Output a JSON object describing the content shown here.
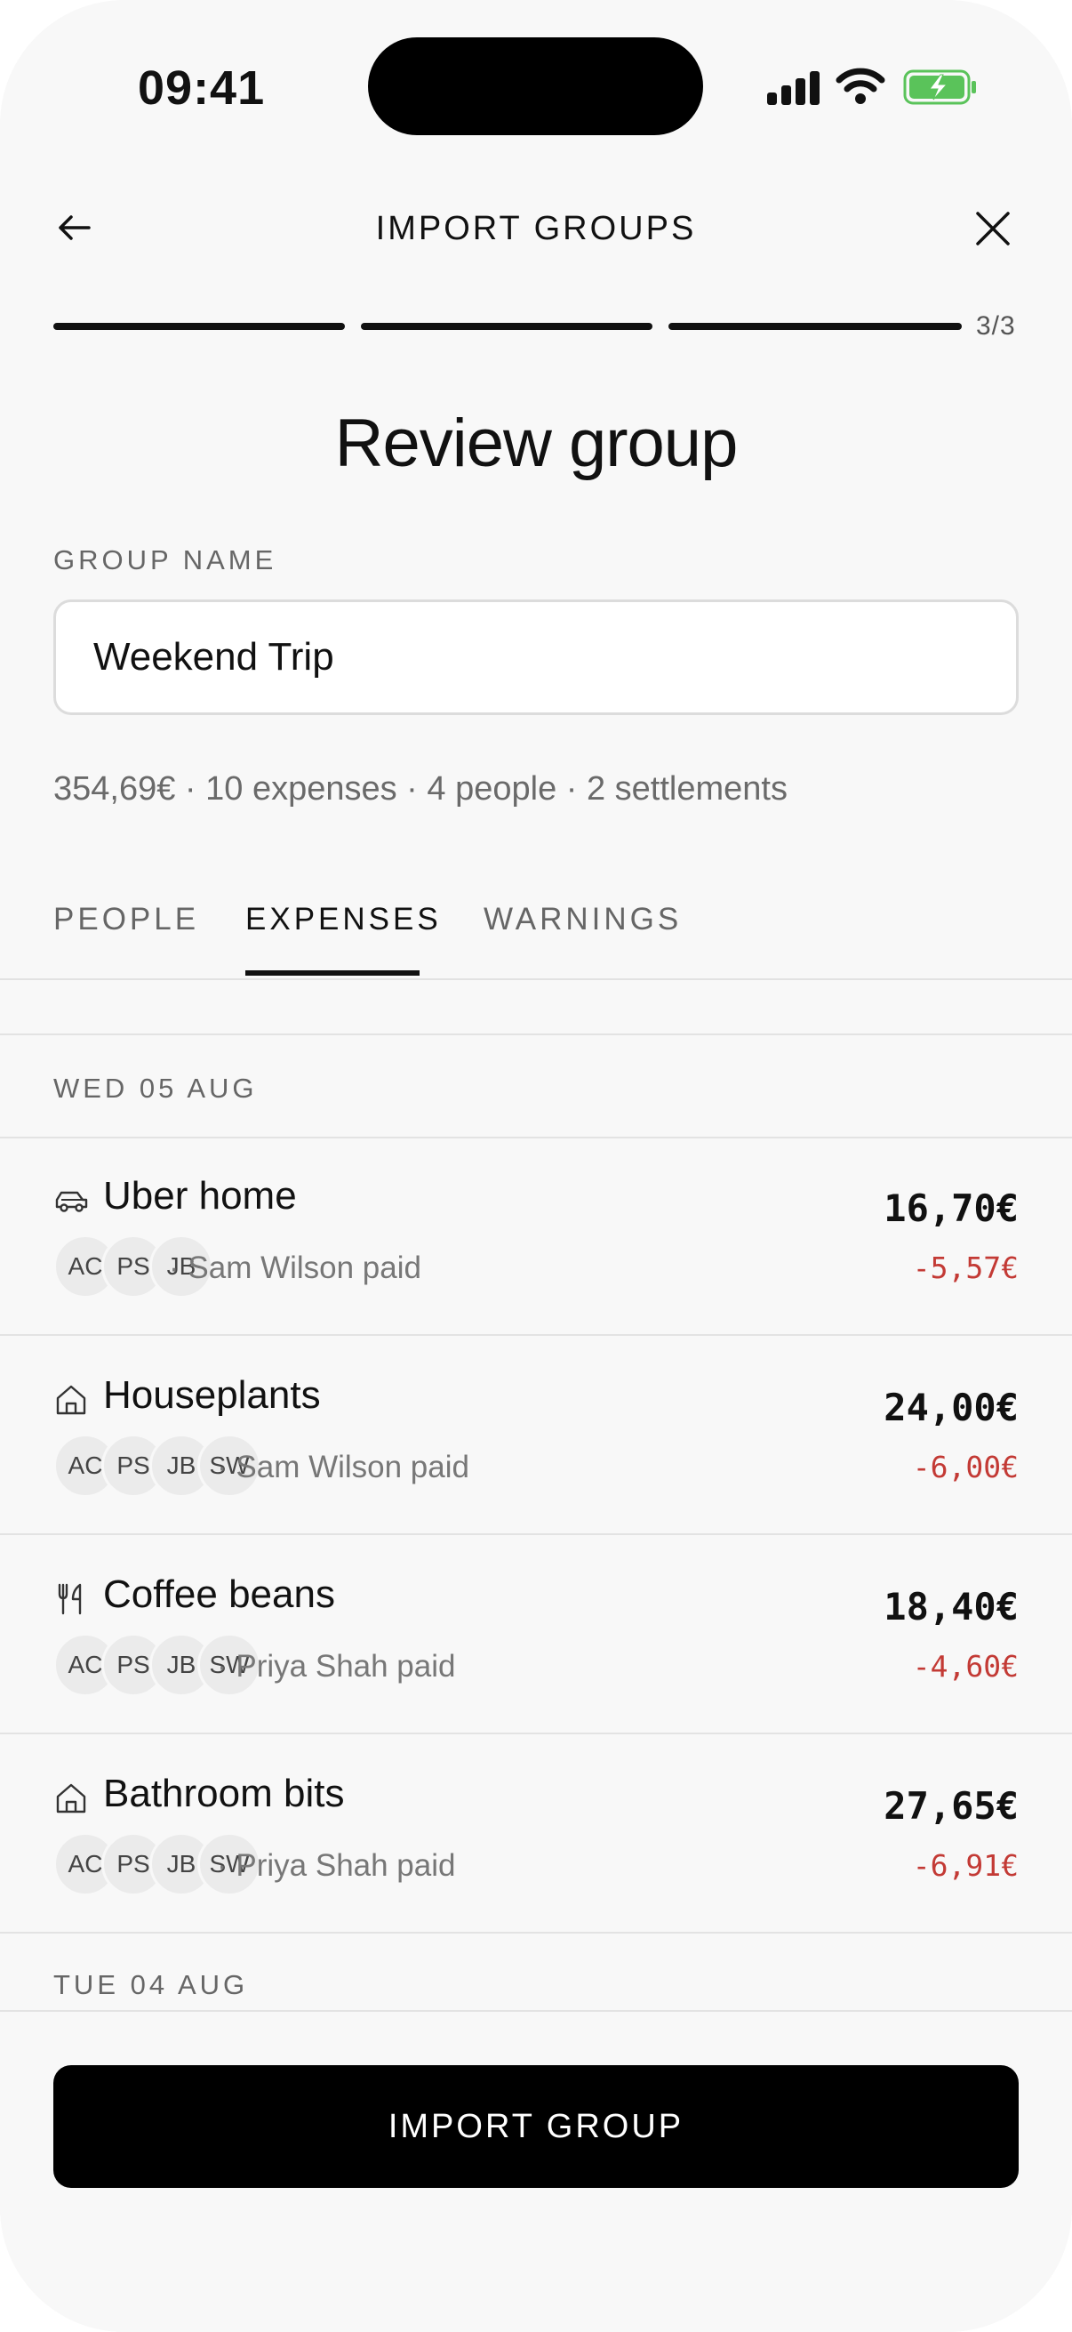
{
  "status_bar": {
    "time": "09:41"
  },
  "header": {
    "title": "IMPORT GROUPS",
    "step": "3/3"
  },
  "page_title": "Review group",
  "group_name": {
    "label": "GROUP NAME",
    "value": "Weekend Trip"
  },
  "summary": "354,69€ · 10 expenses · 4 people · 2 settlements",
  "progress": {
    "completed_steps": 3,
    "total_steps": 3
  },
  "tabs": [
    {
      "label": "PEOPLE",
      "active": false
    },
    {
      "label": "EXPENSES",
      "active": true
    },
    {
      "label": "WARNINGS",
      "active": false
    }
  ],
  "days": [
    {
      "label": "WED 05 AUG",
      "expenses": [
        {
          "title": "Uber home",
          "icon": "car-icon",
          "avatars": [
            "AC",
            "PS",
            "JB"
          ],
          "paid": "· Sam Wilson paid",
          "amount": "16,70€",
          "share": "-5,57€"
        },
        {
          "title": "Houseplants",
          "icon": "home-icon",
          "avatars": [
            "AC",
            "PS",
            "JB",
            "SW"
          ],
          "paid": "· Sam Wilson paid",
          "amount": "24,00€",
          "share": "-6,00€"
        },
        {
          "title": "Coffee beans",
          "icon": "cutlery-icon",
          "avatars": [
            "AC",
            "PS",
            "JB",
            "SW"
          ],
          "paid": "· Priya Shah paid",
          "amount": "18,40€",
          "share": "-4,60€"
        },
        {
          "title": "Bathroom bits",
          "icon": "home-icon",
          "avatars": [
            "AC",
            "PS",
            "JB",
            "SW"
          ],
          "paid": "· Priya Shah paid",
          "amount": "27,65€",
          "share": "-6,91€"
        }
      ]
    },
    {
      "label": "TUE 04 AUG",
      "expenses": []
    }
  ],
  "footer": {
    "button_label": "IMPORT GROUP"
  },
  "colors": {
    "negative": "#c33a35",
    "primary": "#000000",
    "background": "#f8f8f8"
  }
}
